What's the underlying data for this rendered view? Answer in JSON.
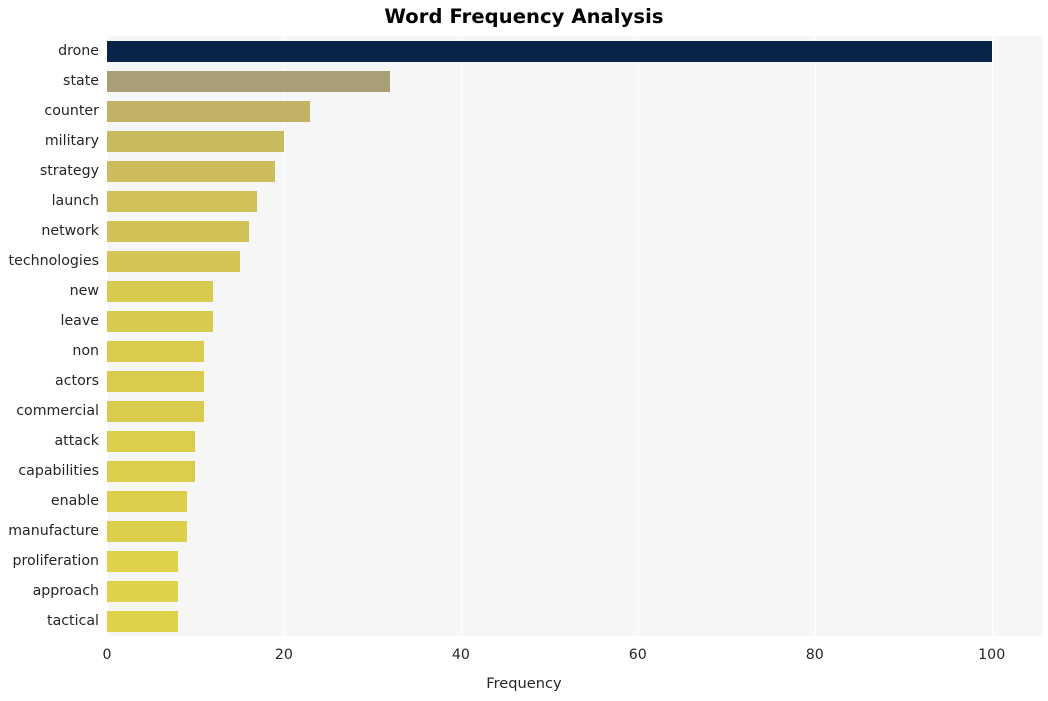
{
  "chart_data": {
    "type": "bar",
    "orientation": "horizontal",
    "title": "Word Frequency Analysis",
    "xlabel": "Frequency",
    "ylabel": "",
    "categories": [
      "drone",
      "state",
      "counter",
      "military",
      "strategy",
      "launch",
      "network",
      "technologies",
      "new",
      "leave",
      "non",
      "actors",
      "commercial",
      "attack",
      "capabilities",
      "enable",
      "manufacture",
      "proliferation",
      "approach",
      "tactical"
    ],
    "values": [
      100,
      32,
      23,
      20,
      19,
      17,
      16,
      15,
      12,
      12,
      11,
      11,
      11,
      10,
      10,
      9,
      9,
      8,
      8,
      8
    ],
    "bar_colors": [
      "#0a2348",
      "#a99f77",
      "#c2b265",
      "#c9b95f",
      "#ccbc5c",
      "#d0c057",
      "#d2c255",
      "#d4c453",
      "#d8c94f",
      "#d8c94f",
      "#dacb4d",
      "#dacb4d",
      "#dacb4d",
      "#dccd4c",
      "#dccd4c",
      "#decf4b",
      "#decf4b",
      "#e0d14a",
      "#e0d14a",
      "#e0d14a"
    ],
    "xlim": [
      0,
      105.8
    ],
    "xticks": [
      0,
      20,
      40,
      60,
      80,
      100
    ],
    "xticklabels": [
      "0",
      "20",
      "40",
      "60",
      "80",
      "100"
    ],
    "grid": true,
    "grid_axis": "x",
    "grid_color": "#ffffff",
    "plot_background": "#f6f6f7",
    "figure_background": "#ffffff",
    "legend": null
  }
}
